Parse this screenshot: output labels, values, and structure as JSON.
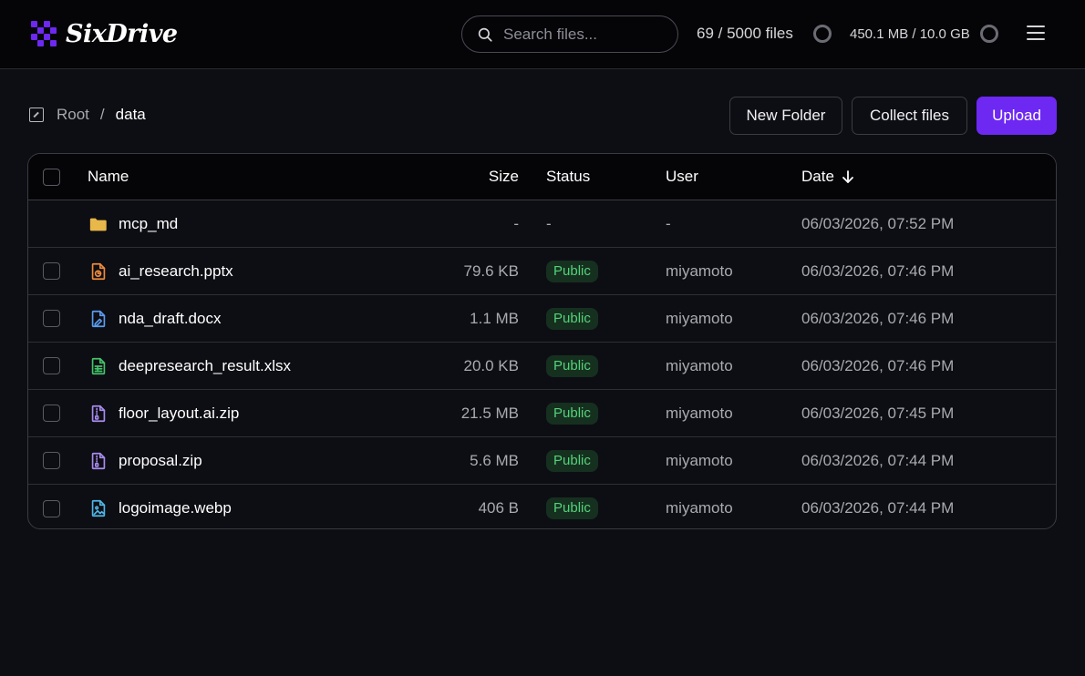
{
  "app": {
    "name": "SixDrive",
    "logo_colors": [
      "#6d28f2",
      "#8b5cf6"
    ]
  },
  "header": {
    "search_placeholder": "Search files...",
    "files_quota": "69 / 5000 files",
    "storage_quota": "450.1 MB / 10.0 GB"
  },
  "breadcrumb": {
    "root": "Root",
    "separator": "/",
    "current": "data"
  },
  "toolbar": {
    "new_folder": "New Folder",
    "collect_files": "Collect files",
    "upload": "Upload",
    "accent_color": "#6d28f2"
  },
  "table": {
    "columns": {
      "name": "Name",
      "size": "Size",
      "status": "Status",
      "user": "User",
      "date": "Date"
    },
    "sort_column": "date",
    "rows": [
      {
        "type": "folder",
        "icon": "folder-icon",
        "icon_color": "#e9b84a",
        "name": "mcp_md",
        "size": "-",
        "status": "-",
        "user": "-",
        "date": "06/03/2026, 07:52 PM"
      },
      {
        "type": "file",
        "icon": "presentation-file-icon",
        "icon_color": "#f08a3c",
        "name": "ai_research.pptx",
        "size": "79.6 KB",
        "status": "Public",
        "user": "miyamoto",
        "date": "06/03/2026, 07:46 PM"
      },
      {
        "type": "file",
        "icon": "document-file-icon",
        "icon_color": "#5b9cf0",
        "name": "nda_draft.docx",
        "size": "1.1 MB",
        "status": "Public",
        "user": "miyamoto",
        "date": "06/03/2026, 07:46 PM"
      },
      {
        "type": "file",
        "icon": "spreadsheet-file-icon",
        "icon_color": "#44c26a",
        "name": "deepresearch_result.xlsx",
        "size": "20.0 KB",
        "status": "Public",
        "user": "miyamoto",
        "date": "06/03/2026, 07:46 PM"
      },
      {
        "type": "file",
        "icon": "archive-file-icon",
        "icon_color": "#a98bf0",
        "name": "floor_layout.ai.zip",
        "size": "21.5 MB",
        "status": "Public",
        "user": "miyamoto",
        "date": "06/03/2026, 07:45 PM"
      },
      {
        "type": "file",
        "icon": "archive-file-icon",
        "icon_color": "#a98bf0",
        "name": "proposal.zip",
        "size": "5.6 MB",
        "status": "Public",
        "user": "miyamoto",
        "date": "06/03/2026, 07:44 PM"
      },
      {
        "type": "file",
        "icon": "image-file-icon",
        "icon_color": "#4fb6e8",
        "name": "logoimage.webp",
        "size": "406 B",
        "status": "Public",
        "user": "miyamoto",
        "date": "06/03/2026, 07:44 PM"
      }
    ]
  }
}
